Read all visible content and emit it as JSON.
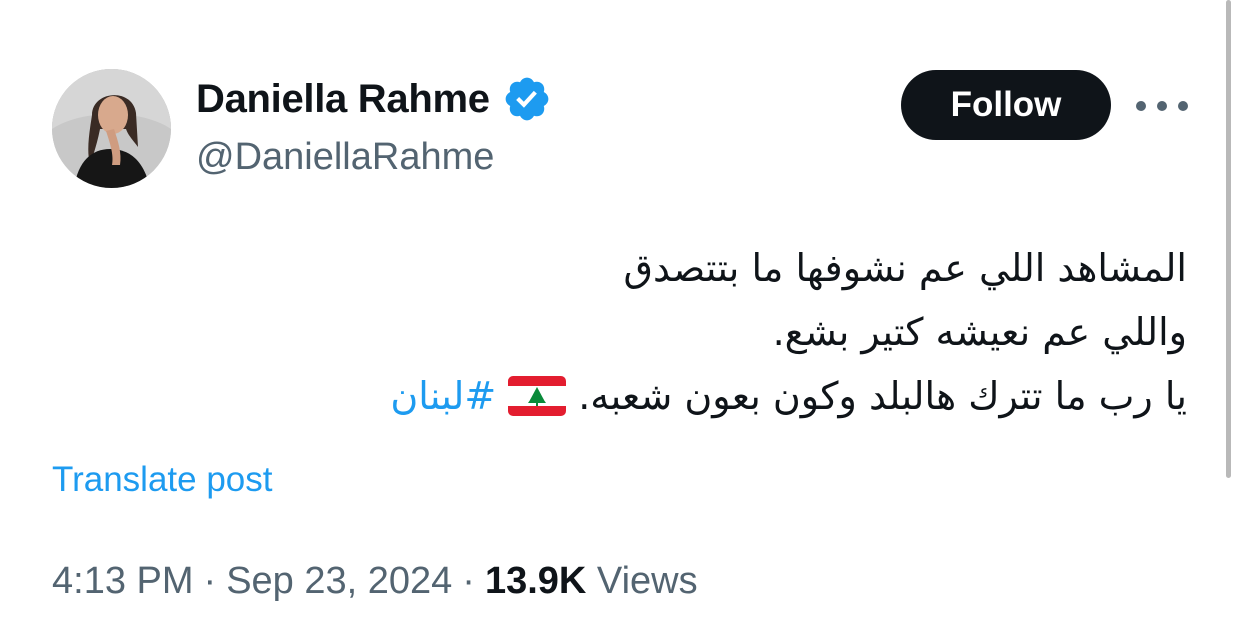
{
  "author": {
    "display_name": "Daniella Rahme",
    "handle": "@DaniellaRahme",
    "verified": true
  },
  "actions": {
    "follow_label": "Follow",
    "more_icon": "more-horizontal-icon"
  },
  "tweet": {
    "line1": "المشاهد اللي عم نشوفها ما بتتصدق",
    "line2": "واللي عم نعيشه كتير بشع.",
    "line3_text": "يا رب ما تترك هالبلد وكون بعون شعبه.",
    "flag_icon": "lebanon-flag-icon",
    "hashtag": "#لبنان"
  },
  "translate_label": "Translate post",
  "meta": {
    "time": "4:13 PM",
    "sep1": "·",
    "date": "Sep 23, 2024",
    "sep2": "·",
    "views_count": "13.9K",
    "views_label": "Views"
  },
  "colors": {
    "text": "#0f1419",
    "secondary": "#536471",
    "link": "#1d9bf0",
    "verified": "#1d9bf0",
    "follow_bg": "#0f1419"
  }
}
